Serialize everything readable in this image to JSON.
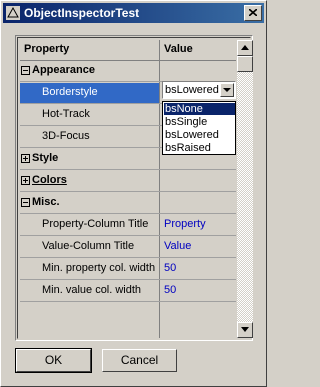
{
  "window": {
    "title": "ObjectInspectorTest"
  },
  "inspector": {
    "header": {
      "property": "Property",
      "value": "Value"
    },
    "rows": [
      {
        "label": "Appearance",
        "kind": "category",
        "expanded": true,
        "value": ""
      },
      {
        "label": "Borderstyle",
        "kind": "item",
        "selected": true,
        "value": "bsLowered"
      },
      {
        "label": "Hot-Track",
        "kind": "item",
        "value": ""
      },
      {
        "label": "3D-Focus",
        "kind": "item",
        "value": ""
      },
      {
        "label": "Style",
        "kind": "category",
        "expanded": false,
        "value": ""
      },
      {
        "label": "Colors",
        "kind": "category",
        "expanded": false,
        "underlined": true,
        "value": ""
      },
      {
        "label": "Misc.",
        "kind": "category",
        "expanded": true,
        "value": ""
      },
      {
        "label": "Property-Column Title",
        "kind": "item",
        "value": "Property"
      },
      {
        "label": "Value-Column Title",
        "kind": "item",
        "value": "Value"
      },
      {
        "label": "Min. property col. width",
        "kind": "item",
        "value": "50"
      },
      {
        "label": "Min. value col. width",
        "kind": "item",
        "value": "50"
      }
    ],
    "combo": {
      "value": "bsLowered",
      "options": [
        "bsNone",
        "bsSingle",
        "bsLowered",
        "bsRaised"
      ],
      "highlighted_option": "bsNone"
    }
  },
  "buttons": {
    "ok": "OK",
    "cancel": "Cancel"
  },
  "colors": {
    "title_bar": "#0a246a",
    "selection": "#3169c6",
    "value_text": "#0000c0",
    "face": "#d4d0c8"
  }
}
